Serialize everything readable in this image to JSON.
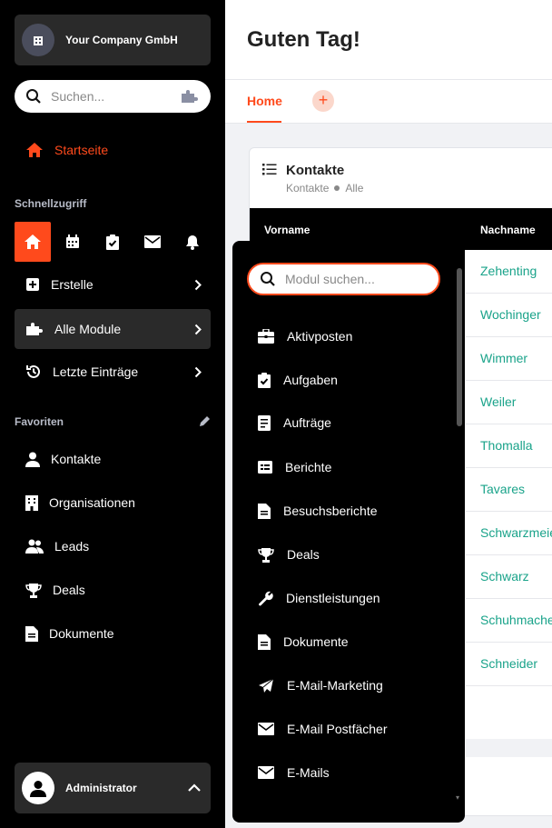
{
  "company": {
    "name": "Your Company GmbH"
  },
  "search": {
    "placeholder": "Suchen..."
  },
  "nav": {
    "start": "Startseite",
    "quick_title": "Schnellzugriff",
    "create": "Erstelle",
    "all_modules": "Alle Module",
    "recent": "Letzte Einträge",
    "favorites_title": "Favoriten",
    "favorites": [
      "Kontakte",
      "Organisationen",
      "Leads",
      "Deals",
      "Dokumente"
    ]
  },
  "user": {
    "name": "Administrator"
  },
  "main": {
    "greeting": "Guten Tag!",
    "tab_home": "Home",
    "tab_add": "+"
  },
  "card": {
    "title": "Kontakte",
    "crumb_1": "Kontakte",
    "crumb_2": "Alle",
    "col_1": "Vorname",
    "col_2": "Nachname",
    "rows": [
      "Zehenting",
      "Wochinger",
      "Wimmer",
      "Weiler",
      "Thomalla",
      "Tavares",
      "Schwarzmeier",
      "Schwarz",
      "Schuhmacher",
      "Schneider"
    ]
  },
  "modules": {
    "placeholder": "Modul suchen...",
    "items": [
      "Aktivposten",
      "Aufgaben",
      "Aufträge",
      "Berichte",
      "Besuchsberichte",
      "Deals",
      "Dienstleistungen",
      "Dokumente",
      "E-Mail-Marketing",
      "E-Mail Postfächer",
      "E-Mails"
    ]
  },
  "colors": {
    "accent": "#ff4a1c",
    "link": "#1aa38a",
    "sidebar": "#000000",
    "panel": "#2a2a2a"
  }
}
